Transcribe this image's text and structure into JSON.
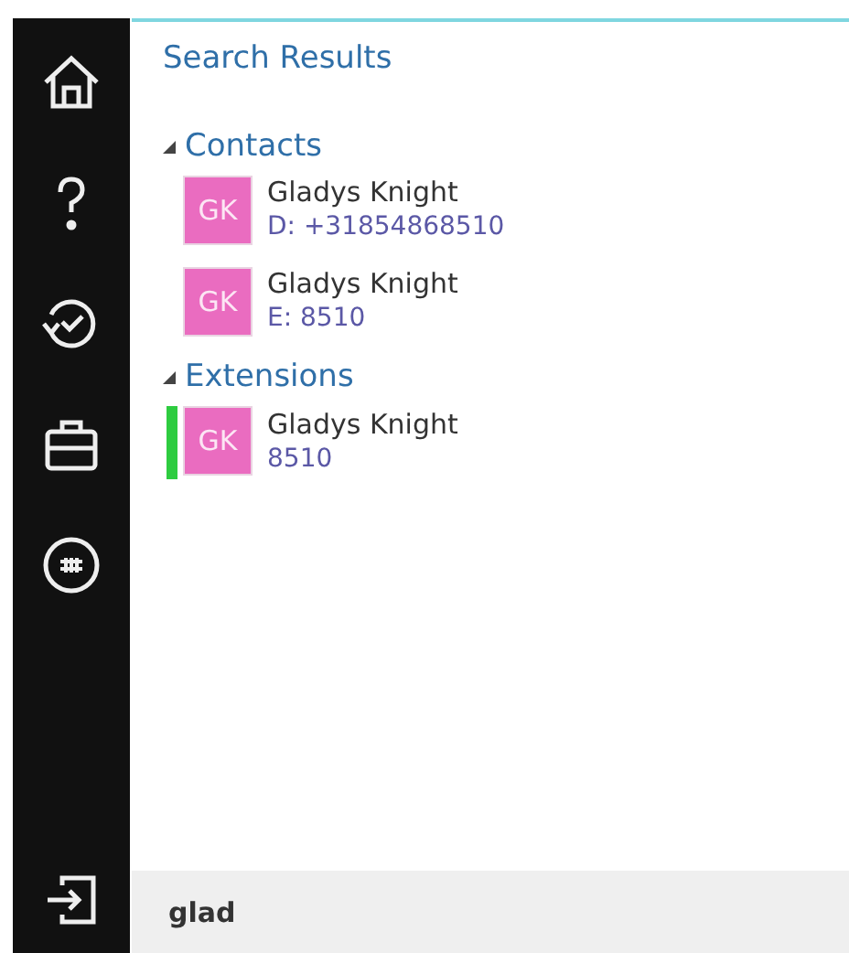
{
  "title": "Search Results",
  "groups": [
    {
      "label": "Contacts",
      "expanded": true,
      "items": [
        {
          "initials": "GK",
          "name": "Gladys Knight",
          "detail": "D: +31854868510"
        },
        {
          "initials": "GK",
          "name": "Gladys Knight",
          "detail": "E: 8510"
        }
      ]
    },
    {
      "label": "Extensions",
      "expanded": true,
      "items": [
        {
          "initials": "GK",
          "name": "Gladys Knight",
          "detail": "8510",
          "color": "#2ecc40"
        }
      ]
    }
  ],
  "search": {
    "value": "glad"
  }
}
